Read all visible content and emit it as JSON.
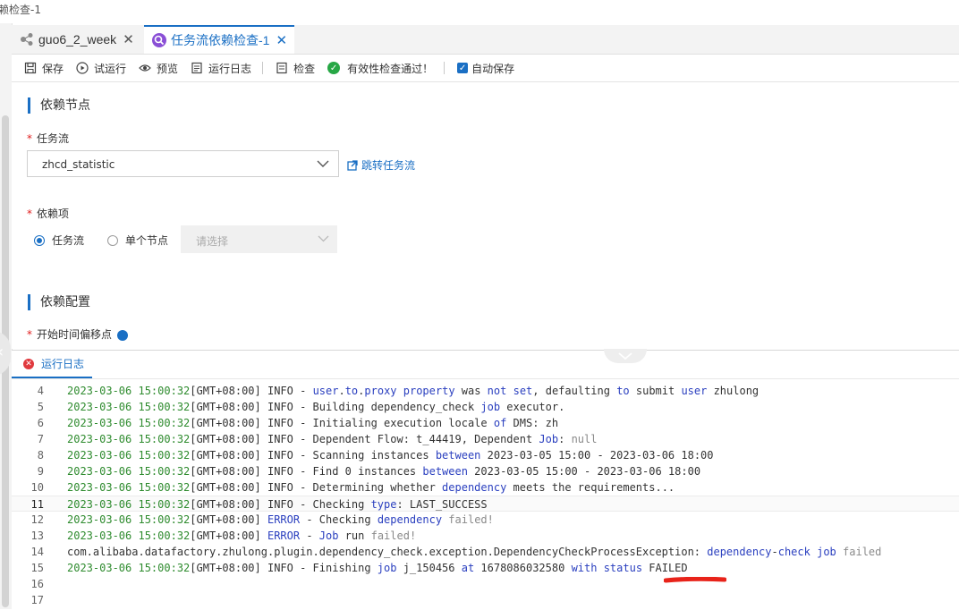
{
  "window": {
    "title": "赖检查-1"
  },
  "tabs": [
    {
      "label": "guo6_2_week",
      "icon": "workflow-icon"
    },
    {
      "label": "任务流依赖检查-1",
      "icon": "dependency-check-icon"
    }
  ],
  "toolbar": {
    "save": "保存",
    "trial_run": "试运行",
    "preview": "预览",
    "run_log": "运行日志",
    "check": "检查",
    "validity": "有效性检查通过！",
    "autosave": "自动保存"
  },
  "section_dep_node": {
    "title": "依赖节点",
    "flow_label": "任务流",
    "flow_value": "zhcd_statistic",
    "jump_link": "跳转任务流",
    "item_label": "依赖项",
    "radio_flow": "任务流",
    "radio_node": "单个节点",
    "node_placeholder": "请选择"
  },
  "section_dep_config": {
    "title": "依赖配置",
    "start_offset_label": "开始时间偏移点"
  },
  "log": {
    "tab_label": "运行日志",
    "lines": [
      {
        "n": "4",
        "ts": "2023-03-06 15:00:32",
        "rest": "[GMT+08:00] INFO - user.to.proxy property was not set, defaulting to submit user zhulong"
      },
      {
        "n": "5",
        "ts": "2023-03-06 15:00:32",
        "rest": "[GMT+08:00] INFO - Building dependency_check job executor."
      },
      {
        "n": "6",
        "ts": "2023-03-06 15:00:32",
        "rest": "[GMT+08:00] INFO - Initialing execution locale of DMS: zh"
      },
      {
        "n": "7",
        "ts": "2023-03-06 15:00:32",
        "rest": "[GMT+08:00] INFO - Dependent Flow: t_44419, Dependent Job: null"
      },
      {
        "n": "8",
        "ts": "2023-03-06 15:00:32",
        "rest": "[GMT+08:00] INFO - Scanning instances between 2023-03-05 15:00 - 2023-03-06 18:00"
      },
      {
        "n": "9",
        "ts": "2023-03-06 15:00:32",
        "rest": "[GMT+08:00] INFO - Find 0 instances between 2023-03-05 15:00 - 2023-03-06 18:00"
      },
      {
        "n": "10",
        "ts": "2023-03-06 15:00:32",
        "rest": "[GMT+08:00] INFO - Determining whether dependency meets the requirements..."
      },
      {
        "n": "11",
        "ts": "2023-03-06 15:00:32",
        "rest": "[GMT+08:00] INFO - Checking type: LAST_SUCCESS"
      },
      {
        "n": "12",
        "ts": "2023-03-06 15:00:32",
        "rest": "[GMT+08:00] ERROR - Checking dependency failed!"
      },
      {
        "n": "13",
        "ts": "2023-03-06 15:00:32",
        "rest": "[GMT+08:00] ERROR - Job run failed!"
      },
      {
        "n": "14",
        "ts": "",
        "rest": "com.alibaba.datafactory.zhulong.plugin.dependency_check.exception.DependencyCheckProcessException: dependency-check job failed"
      },
      {
        "n": "15",
        "ts": "2023-03-06 15:00:32",
        "rest": "[GMT+08:00] INFO - Finishing job j_150456 at 1678086032580 with status FAILED"
      },
      {
        "n": "16",
        "ts": "",
        "rest": ""
      },
      {
        "n": "17",
        "ts": "",
        "rest": ""
      }
    ]
  },
  "colors": {
    "accent": "#1a6fc4",
    "success": "#27a745",
    "error": "#e0393e",
    "timestamp": "#2e8b2e",
    "annotation": "#e8231a"
  }
}
